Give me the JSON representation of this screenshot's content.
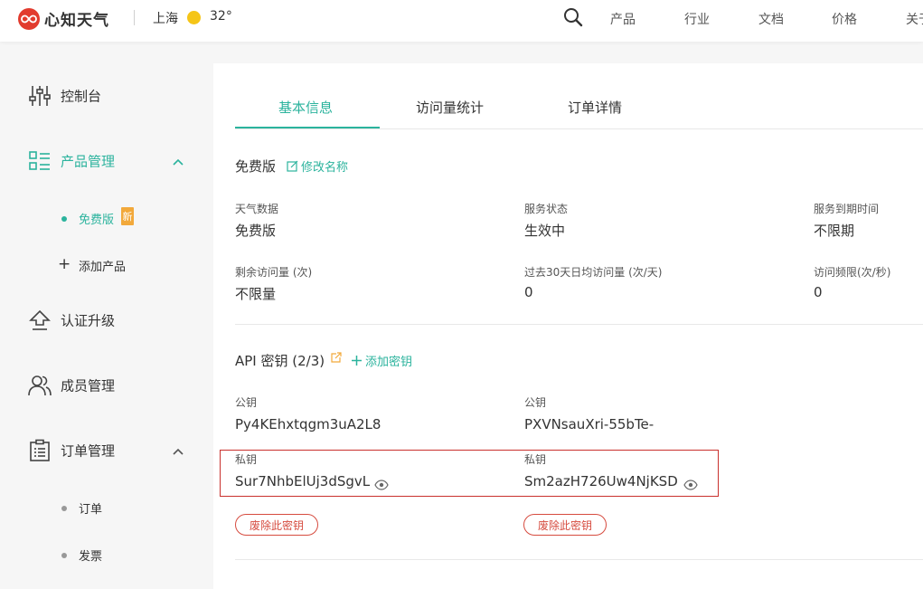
{
  "header": {
    "brand": "心知天气",
    "city": "上海",
    "temperature": "32°",
    "nav": [
      "产品",
      "行业",
      "文档",
      "价格",
      "关于"
    ]
  },
  "sidebar": {
    "items": [
      {
        "label": "控制台"
      },
      {
        "label": "产品管理",
        "active": true
      },
      {
        "label": "认证升级"
      },
      {
        "label": "成员管理"
      },
      {
        "label": "订单管理"
      }
    ],
    "product_sub": [
      {
        "label": "免费版",
        "badge": "新",
        "active": true
      },
      {
        "label": "添加产品"
      }
    ],
    "order_sub": [
      {
        "label": "订单"
      },
      {
        "label": "发票"
      }
    ]
  },
  "tabs": [
    "基本信息",
    "访问量统计",
    "订单详情"
  ],
  "plan": {
    "title": "免费版",
    "edit_label": "修改名称"
  },
  "info": [
    {
      "label": "天气数据",
      "value": "免费版"
    },
    {
      "label": "服务状态",
      "value": "生效中"
    },
    {
      "label": "服务到期时间",
      "value": "不限期"
    },
    {
      "label": "剩余访问量 (次)",
      "value": "不限量"
    },
    {
      "label": "过去30天日均访问量 (次/天)",
      "value": "0"
    },
    {
      "label": "访问频限(次/秒)",
      "value": "0"
    }
  ],
  "api": {
    "title": "API 密钥 (2/3)",
    "add_label": "添加密钥",
    "keys": [
      {
        "public_label": "公钥",
        "public": "Py4KEhxtqgm3uA2L8",
        "private_label": "私钥",
        "private": "Sur7NhbElUj3dSgvL",
        "revoke": "废除此密钥"
      },
      {
        "public_label": "公钥",
        "public": "PXVNsauXri-55bTe-",
        "private_label": "私钥",
        "private": "Sm2azH726Uw4NjKSD",
        "revoke": "废除此密钥"
      }
    ]
  },
  "colors": {
    "accent": "#2bb39d",
    "danger": "#d64b3f",
    "brand": "#e23b2e"
  }
}
